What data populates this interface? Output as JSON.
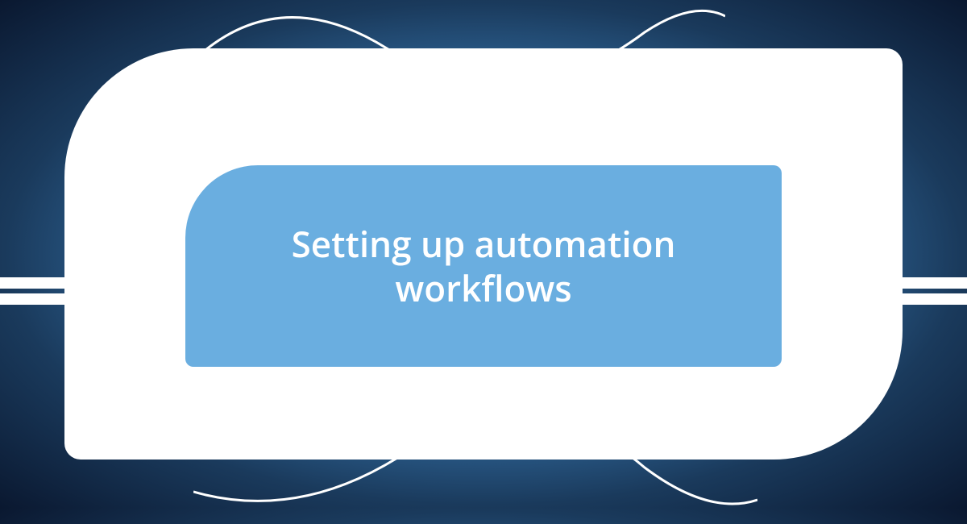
{
  "title": "Setting up automation workflows",
  "colors": {
    "outer_card": "#ffffff",
    "inner_card": "#6aaee0",
    "text": "#ffffff"
  }
}
